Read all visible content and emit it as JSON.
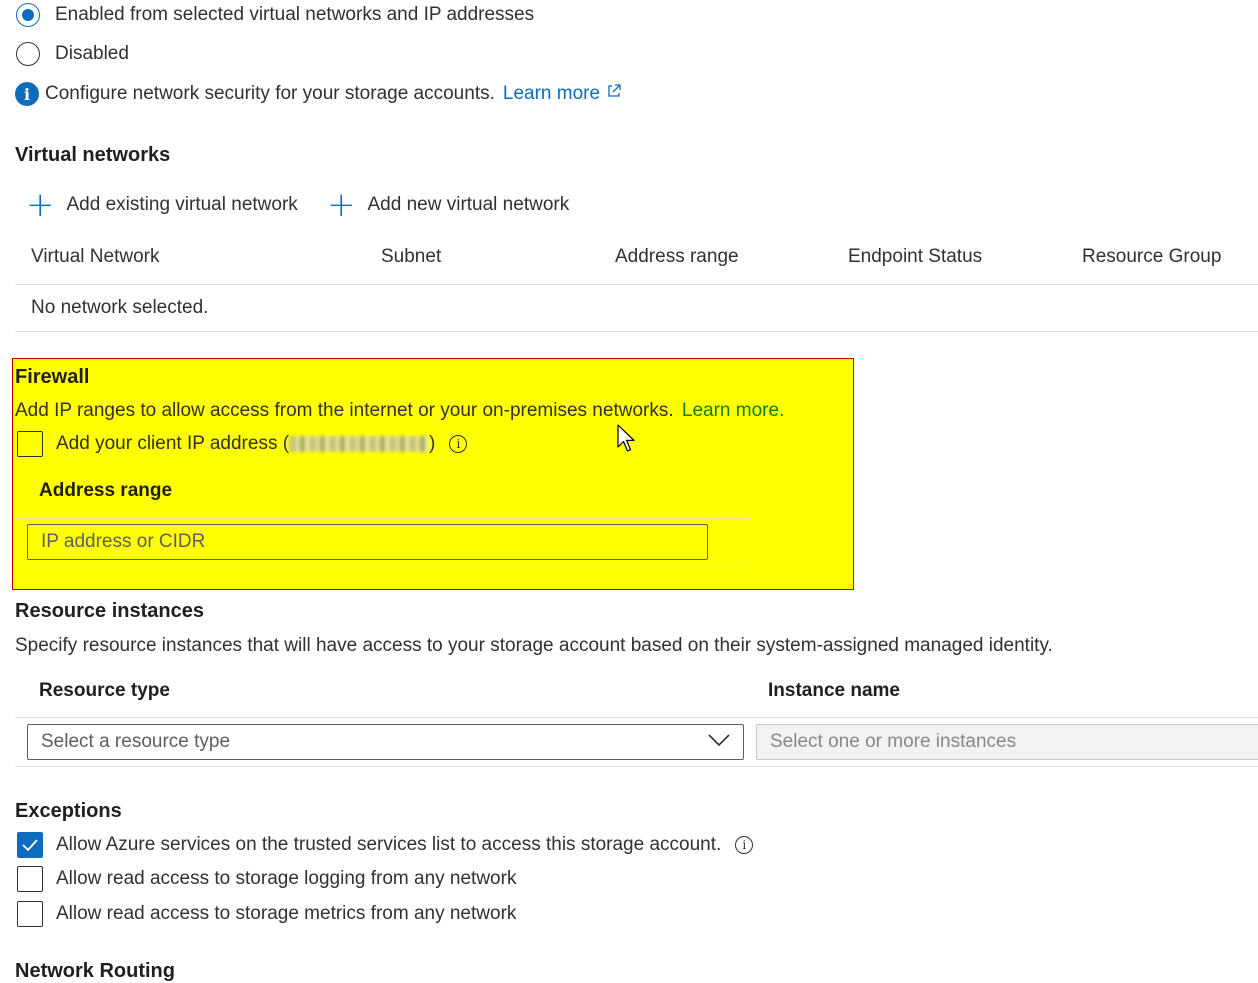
{
  "network_access": {
    "options": [
      {
        "label": "Enabled from selected virtual networks and IP addresses",
        "selected": true
      },
      {
        "label": "Disabled",
        "selected": false
      }
    ],
    "info_text": "Configure network security for your storage accounts.",
    "info_link": "Learn more"
  },
  "virtual_networks": {
    "title": "Virtual networks",
    "add_existing": "Add existing virtual network",
    "add_new": "Add new virtual network",
    "columns": [
      "Virtual Network",
      "Subnet",
      "Address range",
      "Endpoint Status",
      "Resource Group"
    ],
    "empty_text": "No network selected."
  },
  "firewall": {
    "title": "Firewall",
    "description": "Add IP ranges to allow access from the internet or your on-premises networks.",
    "learn_more": "Learn more.",
    "client_ip_prefix": "Add your client IP address (",
    "client_ip_suffix": ")",
    "client_ip_checked": false,
    "address_range_header": "Address range",
    "ip_placeholder": "IP address or CIDR"
  },
  "resource_instances": {
    "title": "Resource instances",
    "description": "Specify resource instances that will have access to your storage account based on their system-assigned managed identity.",
    "resource_type_header": "Resource type",
    "instance_name_header": "Instance name",
    "resource_type_placeholder": "Select a resource type",
    "instance_placeholder": "Select one or more instances"
  },
  "exceptions": {
    "title": "Exceptions",
    "items": [
      {
        "label": "Allow Azure services on the trusted services list to access this storage account.",
        "checked": true
      },
      {
        "label": "Allow read access to storage logging from any network",
        "checked": false
      },
      {
        "label": "Allow read access to storage metrics from any network",
        "checked": false
      }
    ]
  },
  "network_routing": {
    "title": "Network Routing"
  },
  "colors": {
    "accent": "#0f6cbd",
    "highlight": "#ffff00",
    "highlight_border": "#c00000",
    "firewall_link": "#107c10"
  }
}
